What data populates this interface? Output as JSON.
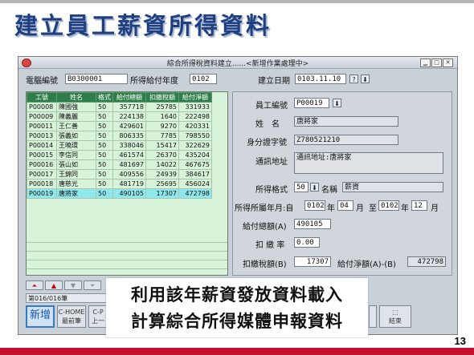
{
  "slide": {
    "title": "建立員工薪資所得資料",
    "page_number": "13",
    "overlay_line1": "利用該年薪資發放資料載入",
    "overlay_line2": "計算綜合所得媒體申報資料"
  },
  "window": {
    "title": "綜合所得稅資料建立......<新增作業處理中>"
  },
  "header": {
    "computer_id_label": "電腦編號",
    "computer_id_value": "B0300001",
    "year_label": "所得給付年度",
    "year_value": "0102",
    "date_label": "建立日期",
    "date_value": "0103.11.10"
  },
  "grid": {
    "columns": [
      "工號",
      "姓名",
      "格式",
      "給付總額",
      "扣繳稅額",
      "給付淨額"
    ],
    "rows": [
      [
        "P00008",
        "陳國強",
        "50",
        "357718",
        "25785",
        "331933"
      ],
      [
        "P00009",
        "陳義麗",
        "50",
        "224138",
        "1640",
        "222498"
      ],
      [
        "P00011",
        "王仁善",
        "50",
        "429601",
        "9270",
        "420331"
      ],
      [
        "P00013",
        "張義如",
        "50",
        "806335",
        "7785",
        "798550"
      ],
      [
        "P00014",
        "王曉環",
        "50",
        "338046",
        "15417",
        "322629"
      ],
      [
        "P00015",
        "李信同",
        "50",
        "461574",
        "26370",
        "435204"
      ],
      [
        "P00016",
        "張山如",
        "50",
        "481697",
        "14022",
        "467675"
      ],
      [
        "P00017",
        "王錦同",
        "50",
        "409556",
        "24939",
        "384617"
      ],
      [
        "P00018",
        "唐慈光",
        "50",
        "481719",
        "25695",
        "456024"
      ],
      [
        "P00019",
        "唐將家",
        "50",
        "490105",
        "17307",
        "472798"
      ]
    ],
    "selected_index": 9
  },
  "detail": {
    "emp_id_label": "員工編號",
    "emp_id_value": "P00019",
    "name_label": "姓　名",
    "name_value": "唐將家",
    "idno_label": "身分證字號",
    "idno_value": "Z780521210",
    "address_label": "通訊地址",
    "address_value": "通訊地址:唐將家",
    "format_label": "所得格式",
    "format_value": "50",
    "format_name_label": "名稱",
    "format_name_value": "薪資",
    "period_label": "所得所屬年月:自",
    "period_from_year": "0102",
    "period_year_unit": "年",
    "period_from_month": "04",
    "period_month_unit": "月",
    "period_to_label": "至",
    "period_to_year": "0102",
    "period_to_month": "12",
    "gross_label": "給付總額(A)",
    "gross_value": "490105",
    "rate_label": "扣 繳 率",
    "rate_value": "0.00",
    "tax_label": "扣繳稅額(B)",
    "tax_value": "17307",
    "net_label": "給付淨額(A)-(B)",
    "net_value": "472798"
  },
  "nav": {
    "counter": "第016/016筆"
  },
  "buttons": {
    "add": "新增",
    "first_line1": "C-HOME",
    "first_line2": "最前筆",
    "prev_line1": "C-P",
    "prev_line2": "上一",
    "end": "結束"
  }
}
